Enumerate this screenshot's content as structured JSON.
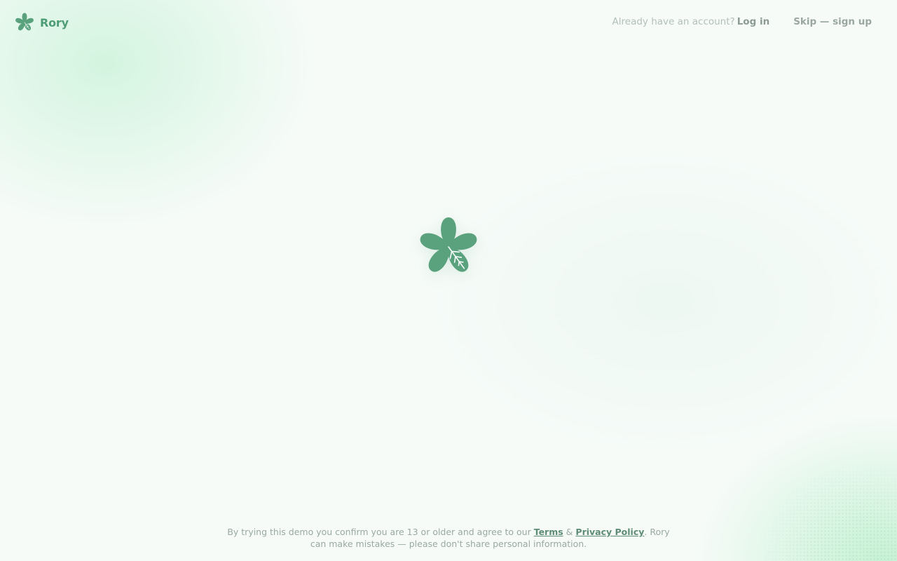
{
  "brand": {
    "name": "Rory",
    "logo_icon": "clover-leaf-icon",
    "color": "#4f9d77"
  },
  "header": {
    "login_prompt": "Already have an account?",
    "login_label": "Log in",
    "skip_label": "Skip — sign up"
  },
  "main": {
    "logo_icon": "clover-leaf-icon"
  },
  "footer": {
    "text_before": "By trying this demo you confirm you are 13 or older and agree to our",
    "terms_label": "Terms",
    "ampersand": "&",
    "privacy_label": "Privacy Policy",
    "text_after": ". Rory",
    "line2": "can make mistakes — please don't share personal information."
  },
  "colors": {
    "accent": "#4f9d77",
    "background": "#f6fbf8",
    "muted_text": "#9aa9a2"
  }
}
